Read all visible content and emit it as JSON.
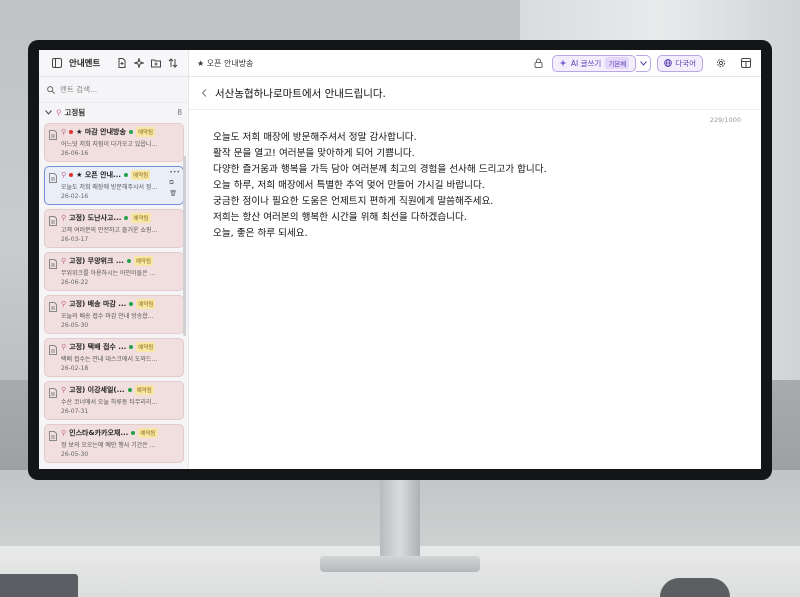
{
  "topbar": {
    "sidebar_title": "안내멘트",
    "active_tab": "★ 오픈 안내방송",
    "ai_button": "AI 글쓰기",
    "ai_badge": "기본체",
    "lang_button": "다국어"
  },
  "sidebar": {
    "search_placeholder": "멘트 검색...",
    "group_label": "고정됨",
    "group_count": "8",
    "items": [
      {
        "title": "★ 마감 안내방송",
        "status": "예약됨",
        "preview": "어느덧 저희 지점이 다가오고 있읍니...",
        "date": "26-06-16",
        "marker": "red"
      },
      {
        "title": "★ 오픈 안내...",
        "status": "예약됨",
        "preview": "오늘도 저희 매장에 방문해주시서 정...",
        "date": "26-02-16",
        "marker": "red",
        "active": true
      },
      {
        "title": "고정) 도난사고...",
        "status": "예약됨",
        "preview": "고객 여러분의 안전하고 즐거운 쇼핑...",
        "date": "26-03-17"
      },
      {
        "title": "고정) 무양위크 ...",
        "status": "예약됨",
        "preview": "무위위크를 아용하시는 아인이들은 ...",
        "date": "26-06-22"
      },
      {
        "title": "고정) 배송 마감 ...",
        "status": "예약됨",
        "preview": "오늘의 배송 접수 마감 안내 방송합...",
        "date": "26-05-30"
      },
      {
        "title": "고정) 택배 접수 ...",
        "status": "예약됨",
        "preview": "택배 접수는 안내 대스크에서 도와드...",
        "date": "26-02-18"
      },
      {
        "title": "고정) 이강세일(...",
        "status": "예약됨",
        "preview": "수산 코너에서 오늘 하루동 타무리리...",
        "date": "26-07-31"
      },
      {
        "title": "인스타&카카오채...",
        "status": "예약됨",
        "preview": "정 보의 오오는에 예만 행사 기간은 ...",
        "date": "26-05-30"
      }
    ]
  },
  "editor": {
    "title": "서산농협하나로마트에서 안내드립니다.",
    "char_count": "229/1000",
    "lines": [
      "오늘도 저희 매장에 방문해주셔서 정말 감사합니다.",
      "활작 문을 열고! 여러분을 맞아하게 되어 기쁩니다.",
      "다양한 즐거움과 행복을 가득 담아 여러분께 최고의 경험을 선사해 드리고가 합니다.",
      "오늘 하루, 저희 매장에서 특별한 추억 멎어 만들어 가시길 바랍니다.",
      "궁금한 점이나 필요한 도움은 언제트지 편하게 직원에게 말씀해주세요.",
      "저희는 항산 여러본의 행복한 시간을 위해 최선을 다하겠습니다.",
      "오늘, 좋은 하루 되세요."
    ]
  }
}
